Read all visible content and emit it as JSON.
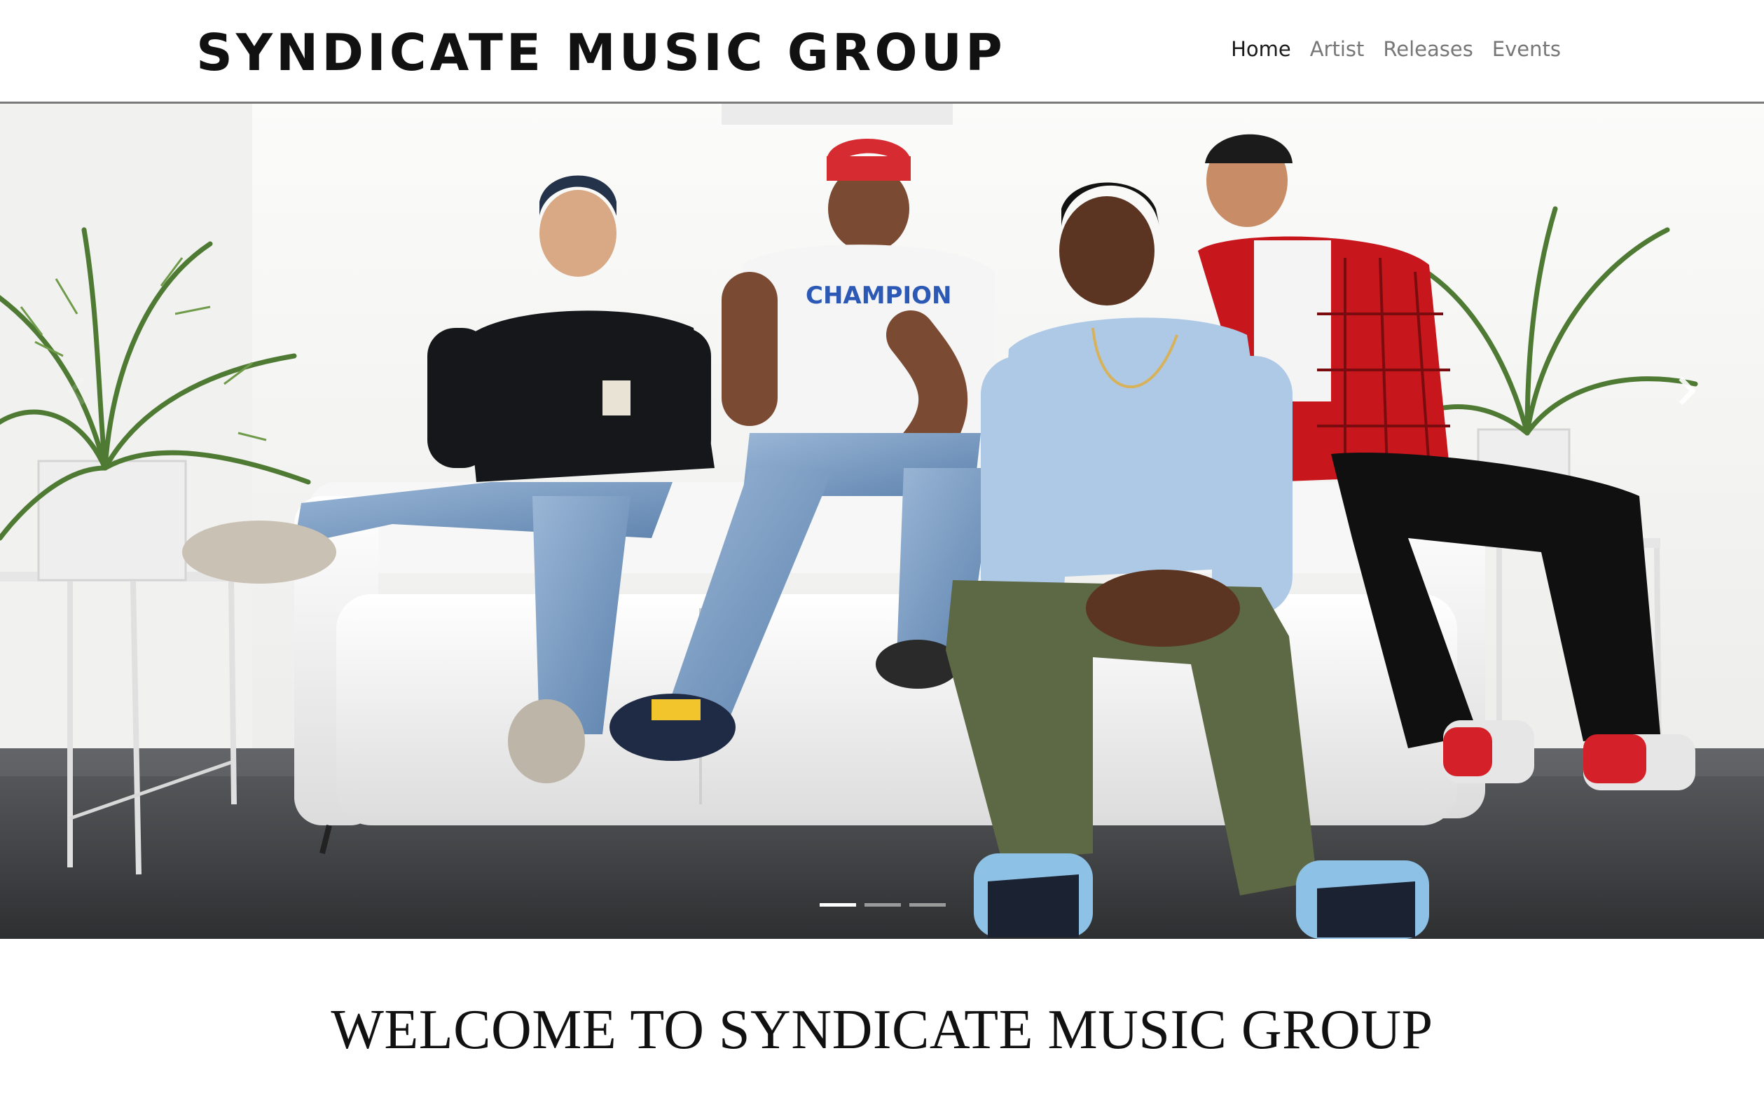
{
  "header": {
    "brand": "SYNDICATE MUSIC GROUP",
    "nav": [
      {
        "label": "Home",
        "active": true
      },
      {
        "label": "Artist",
        "active": false
      },
      {
        "label": "Releases",
        "active": false
      },
      {
        "label": "Events",
        "active": false
      }
    ]
  },
  "carousel": {
    "slide_count": 3,
    "active_slide": 1,
    "next_icon": "chevron-right-icon",
    "prev_icon": "chevron-left-icon"
  },
  "welcome": {
    "heading": "WELCOME TO SYNDICATE MUSIC GROUP"
  },
  "colors": {
    "text_dark": "#111111",
    "nav_inactive": "#777777",
    "header_border": "#7a7a7a"
  }
}
